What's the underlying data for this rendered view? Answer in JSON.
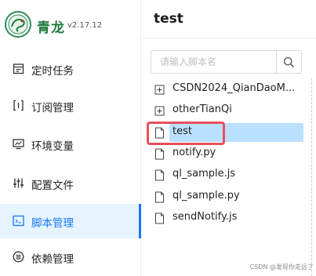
{
  "brand": {
    "name": "青龙",
    "version": "v2.17.12"
  },
  "sidebar": {
    "items": [
      {
        "label": "定时任务",
        "icon": "calendar-icon",
        "active": false
      },
      {
        "label": "订阅管理",
        "icon": "subscription-icon",
        "active": false
      },
      {
        "label": "环境变量",
        "icon": "monitor-icon",
        "active": false
      },
      {
        "label": "配置文件",
        "icon": "sliders-icon",
        "active": false
      },
      {
        "label": "脚本管理",
        "icon": "code-icon",
        "active": true
      },
      {
        "label": "依赖管理",
        "icon": "dependency-icon",
        "active": false
      }
    ]
  },
  "main": {
    "title": "test",
    "search": {
      "placeholder": "请输入脚本名",
      "value": ""
    },
    "tree": [
      {
        "label": "CSDN2024_QianDaoM...",
        "type": "folder-collapsed"
      },
      {
        "label": "otherTianQi",
        "type": "folder-collapsed"
      },
      {
        "label": "test",
        "type": "file",
        "selected": true
      },
      {
        "label": "notify.py",
        "type": "file"
      },
      {
        "label": "ql_sample.js",
        "type": "file"
      },
      {
        "label": "ql_sample.py",
        "type": "file"
      },
      {
        "label": "sendNotify.js",
        "type": "file"
      }
    ]
  },
  "watermark": "CSDN @发现你走远了",
  "colors": {
    "accent": "#1677ff",
    "selected_bg": "#bae0ff",
    "highlight": "#e8505b",
    "brand": "#1f7a3e"
  }
}
